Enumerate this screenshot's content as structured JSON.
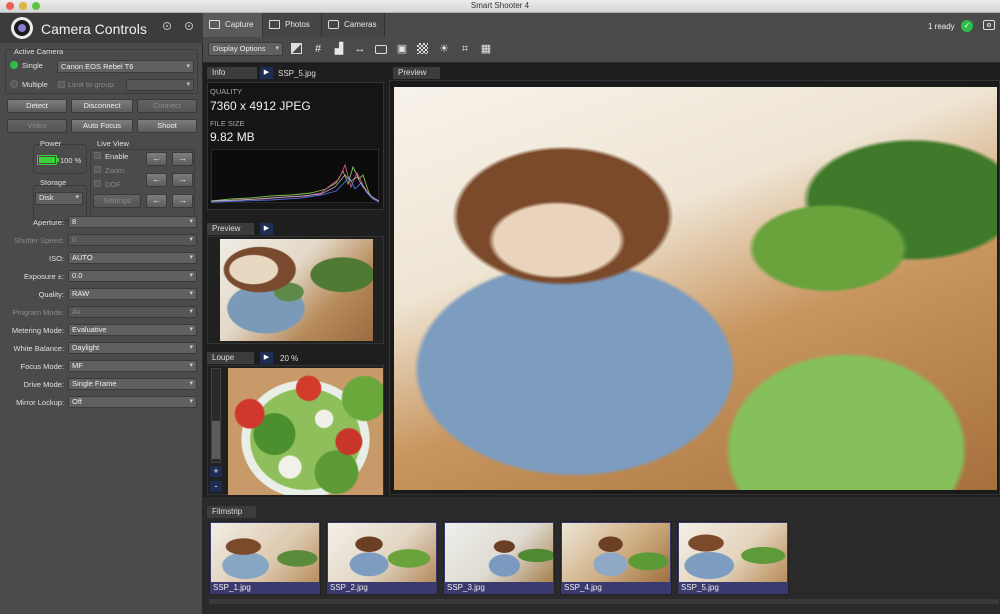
{
  "app": {
    "title": "Smart Shooter 4"
  },
  "left_panel": {
    "title": "Camera Controls",
    "active_camera": {
      "label": "Active Camera",
      "single_label": "Single",
      "single_value": "Canon EOS Rebel T6",
      "multiple_label": "Multiple",
      "limit_label": "Limit to group:"
    },
    "buttons": {
      "detect": "Detect",
      "disconnect": "Disconnect",
      "connect": "Connect",
      "video": "Video",
      "auto_focus": "Auto Focus",
      "shoot": "Shoot"
    },
    "power": {
      "label": "Power",
      "value": "100 %",
      "level": 1.0
    },
    "storage": {
      "label": "Storage",
      "value": "Disk"
    },
    "live_view": {
      "label": "Live View",
      "enable": "Enable",
      "zoom": "Zoom",
      "dof": "DOF",
      "settings": "Settings",
      "arrows": [
        "←",
        "→",
        "←",
        "→",
        "←",
        "→"
      ]
    },
    "properties": [
      {
        "label": "Aperture:",
        "value": "8",
        "disabled": false
      },
      {
        "label": "Shutter Speed:",
        "value": "0",
        "disabled": true
      },
      {
        "label": "ISO:",
        "value": "AUTO",
        "disabled": false
      },
      {
        "label": "Exposure ±:",
        "value": "0.0",
        "disabled": false
      },
      {
        "label": "Quality:",
        "value": "RAW",
        "disabled": false
      },
      {
        "label": "Program Mode:",
        "value": "Av",
        "disabled": true
      },
      {
        "label": "Metering Mode:",
        "value": "Evaluative",
        "disabled": false
      },
      {
        "label": "White Balance:",
        "value": "Daylight",
        "disabled": false
      },
      {
        "label": "Focus Mode:",
        "value": "MF",
        "disabled": false
      },
      {
        "label": "Drive Mode:",
        "value": "Single Frame",
        "disabled": false
      },
      {
        "label": "Mirror Lockup:",
        "value": "Off",
        "disabled": false
      }
    ]
  },
  "tabs": [
    {
      "label": "Capture",
      "active": true
    },
    {
      "label": "Photos",
      "active": false
    },
    {
      "label": "Cameras",
      "active": false
    }
  ],
  "status": {
    "ready_text": "1 ready"
  },
  "toolbar": {
    "display_options": "Display Options",
    "icons": [
      "exposure-icon",
      "grid-icon",
      "histogram-icon",
      "stretch-icon",
      "camera-icon",
      "overlay-icon",
      "checker-icon",
      "sun-icon",
      "crop-icon",
      "qr-icon"
    ]
  },
  "info_panel": {
    "header": "Info",
    "filename": "SSP_5.jpg",
    "quality_label": "QUALITY",
    "quality_value": "7360 x 4912 JPEG",
    "filesize_label": "FILE SIZE",
    "filesize_value": "9.82 MB"
  },
  "preview_small": {
    "header": "Preview"
  },
  "loupe": {
    "header": "Loupe",
    "zoom": "20 %",
    "plus": "+",
    "minus": "-"
  },
  "preview_main": {
    "header": "Preview"
  },
  "filmstrip": {
    "header": "Filmstrip",
    "items": [
      {
        "label": "SSP_1.jpg"
      },
      {
        "label": "SSP_2.jpg"
      },
      {
        "label": "SSP_3.jpg"
      },
      {
        "label": "SSP_4.jpg"
      },
      {
        "label": "SSP_5.jpg"
      }
    ]
  },
  "colors": {
    "panel_bg": "#4b4b4b",
    "view_bg": "#1e1e1e",
    "header_bg": "#3c3c3c",
    "accent_blue": "#1f2d55",
    "filmstrip_label_bg": "#3b3a6e",
    "ready_green": "#2dbd4b",
    "power_green": "#3cd03c"
  }
}
